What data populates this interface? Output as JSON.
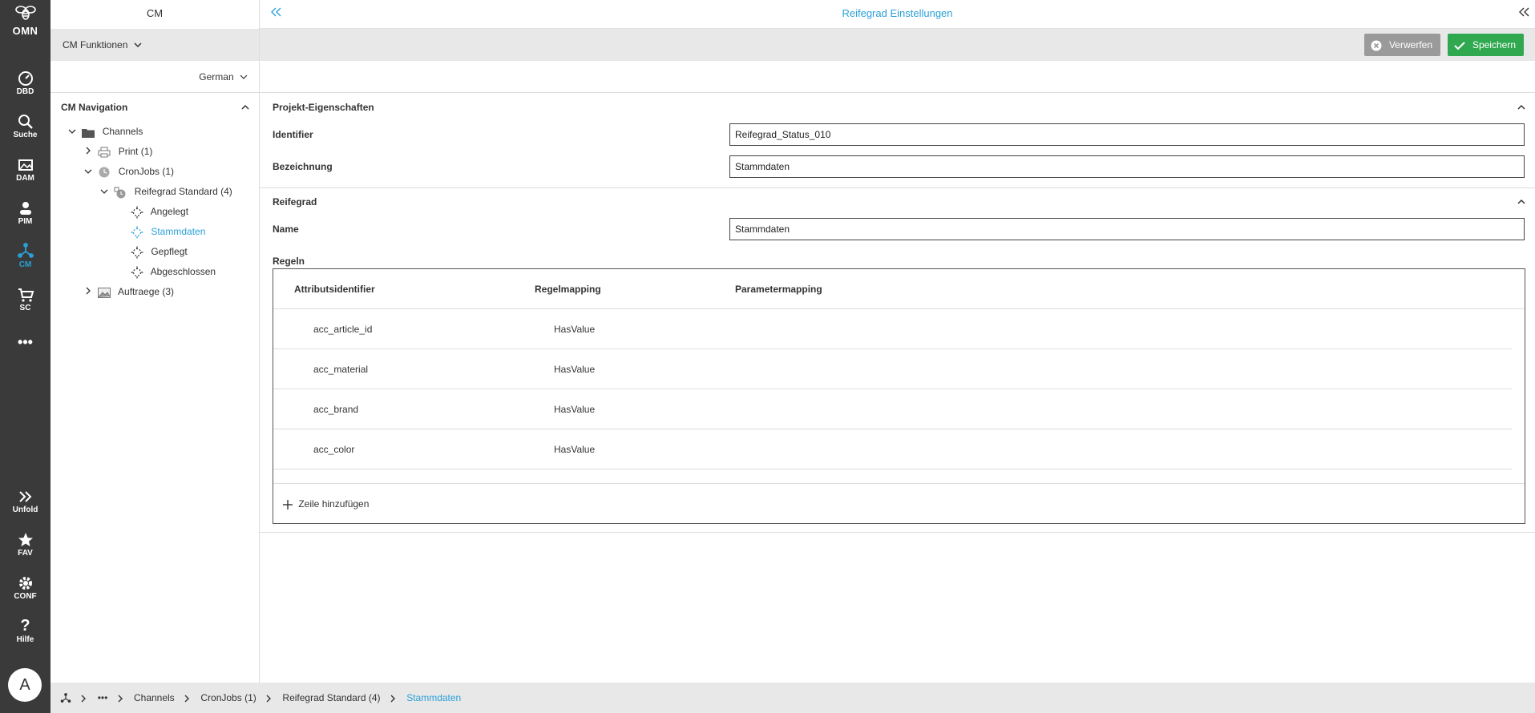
{
  "rail": {
    "logo_text": "OMN",
    "items": [
      {
        "label": "DBD",
        "icon": "dashboard-icon"
      },
      {
        "label": "Suche",
        "icon": "search-icon"
      },
      {
        "label": "DAM",
        "icon": "image-icon"
      },
      {
        "label": "PIM",
        "icon": "pim-icon"
      },
      {
        "label": "CM",
        "icon": "network-icon"
      },
      {
        "label": "SC",
        "icon": "cart-icon"
      },
      {
        "label": "",
        "icon": "more-icon"
      },
      {
        "label": "Unfold",
        "icon": "double-chevron-right-icon"
      },
      {
        "label": "FAV",
        "icon": "star-icon"
      },
      {
        "label": "CONF",
        "icon": "gear-icon"
      },
      {
        "label": "Hilfe",
        "icon": "help-icon"
      }
    ],
    "avatar": "A",
    "active_color": "#2aa0d8"
  },
  "nav": {
    "title": "CM",
    "functions_label": "CM Funktionen",
    "language": "German",
    "section_title": "CM Navigation",
    "tree": [
      {
        "label": "Channels",
        "icon": "folder-icon"
      },
      {
        "label": "Print (1)",
        "icon": "printer-icon"
      },
      {
        "label": "CronJobs (1)",
        "icon": "clock-icon"
      },
      {
        "label": "Reifegrad Standard (4)",
        "icon": "alarm-icon"
      },
      {
        "label": "Angelegt",
        "icon": "status-icon"
      },
      {
        "label": "Stammdaten",
        "icon": "status-icon"
      },
      {
        "label": "Gepflegt",
        "icon": "status-icon"
      },
      {
        "label": "Abgeschlossen",
        "icon": "status-icon"
      },
      {
        "label": "Auftraege (3)",
        "icon": "picture-icon"
      }
    ]
  },
  "main": {
    "title": "Reifegrad Einstellungen",
    "discard_label": "Verwerfen",
    "save_label": "Speichern",
    "section1_title": "Projekt-Eigenschaften",
    "identifier_label": "Identifier",
    "identifier_value": "Reifegrad_Status_010",
    "bezeichnung_label": "Bezeichnung",
    "bezeichnung_value": "Stammdaten",
    "section2_title": "Reifegrad",
    "name_label": "Name",
    "name_value": "Stammdaten",
    "rules_label": "Regeln",
    "rules_columns": [
      "Attributsidentifier",
      "Regelmapping",
      "Parametermapping"
    ],
    "rules_rows": [
      {
        "attr": "acc_article_id",
        "rule": "HasValue",
        "param": ""
      },
      {
        "attr": "acc_material",
        "rule": "HasValue",
        "param": ""
      },
      {
        "attr": "acc_brand",
        "rule": "HasValue",
        "param": ""
      },
      {
        "attr": "acc_color",
        "rule": "HasValue",
        "param": ""
      }
    ],
    "add_row_label": "Zeile hinzufügen",
    "save_color": "#2fa84f",
    "discard_color": "#9a9a9a"
  },
  "breadcrumb": {
    "items": [
      "Channels",
      "CronJobs (1)",
      "Reifegrad Standard (4)",
      "Stammdaten"
    ]
  }
}
